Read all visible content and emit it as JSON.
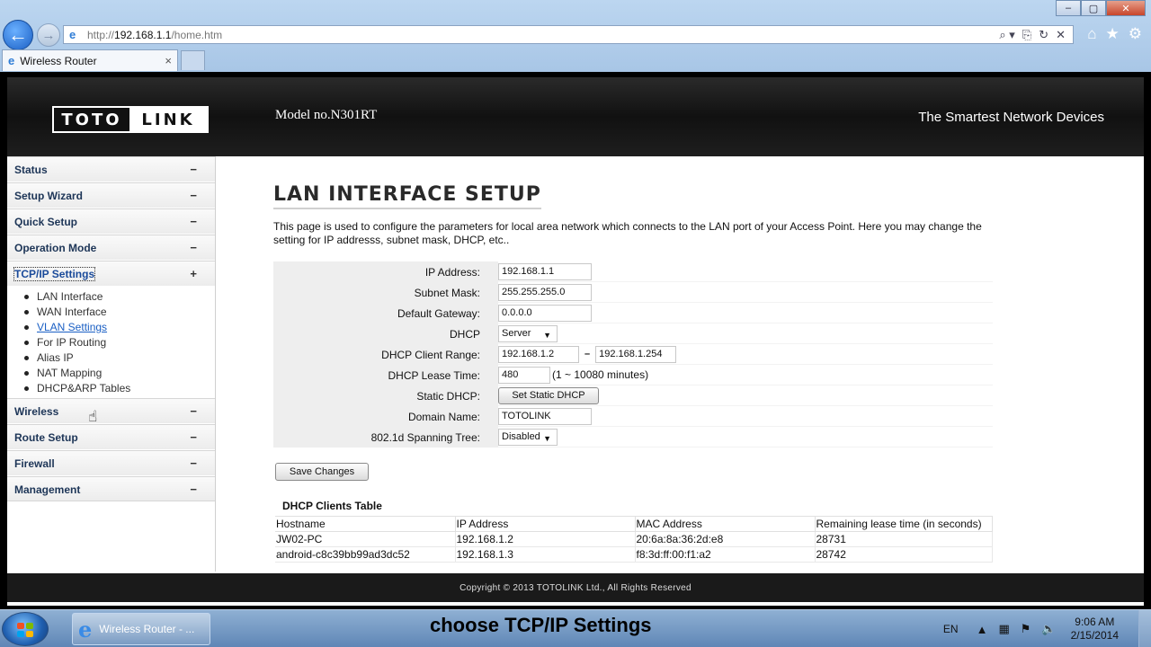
{
  "browser": {
    "url_prefix": "http://",
    "url_host": "192.168.1.1",
    "url_path": "/home.htm",
    "tab_title": "Wireless Router",
    "tab_close": "×",
    "window_buttons": [
      "–",
      "▢",
      "✕"
    ],
    "address_tools": [
      "⌕ ▾",
      "⎘",
      "↻",
      "✕"
    ],
    "toolbar_icons": {
      "home": "⌂",
      "favorites": "★",
      "tools": "⚙"
    }
  },
  "banner": {
    "logo_left": "TOTO",
    "logo_right": "LINK",
    "model": "Model no.N301RT",
    "slogan": "The Smartest Network Devices"
  },
  "sidebar": {
    "items": [
      {
        "label": "Status",
        "sign": "−"
      },
      {
        "label": "Setup Wizard",
        "sign": "−"
      },
      {
        "label": "Quick Setup",
        "sign": "−"
      },
      {
        "label": "Operation Mode",
        "sign": "−"
      },
      {
        "label": "TCP/IP Settings",
        "sign": "+"
      },
      {
        "label": "Wireless",
        "sign": "−"
      },
      {
        "label": "Route Setup",
        "sign": "−"
      },
      {
        "label": "Firewall",
        "sign": "−"
      },
      {
        "label": "Management",
        "sign": "−"
      }
    ],
    "submenu": [
      "LAN Interface",
      "WAN Interface",
      "VLAN Settings",
      "For IP Routing",
      "Alias IP",
      "NAT Mapping",
      "DHCP&ARP Tables"
    ]
  },
  "content": {
    "title": "LAN INTERFACE SETUP",
    "description": "This page is used to configure the parameters for local area network which connects to the LAN port of your Access Point. Here you may change the setting for IP addresss, subnet mask, DHCP, etc..",
    "form": {
      "ip_label": "IP Address:",
      "ip_value": "192.168.1.1",
      "mask_label": "Subnet Mask:",
      "mask_value": "255.255.255.0",
      "gateway_label": "Default Gateway:",
      "gateway_value": "0.0.0.0",
      "dhcp_label": "DHCP",
      "dhcp_value": "Server",
      "range_label": "DHCP Client Range:",
      "range_start": "192.168.1.2",
      "range_sep": "–",
      "range_end": "192.168.1.254",
      "lease_label": "DHCP Lease Time:",
      "lease_value": "480",
      "lease_hint": "(1 ~ 10080 minutes)",
      "static_label": "Static DHCP:",
      "static_button": "Set Static DHCP",
      "domain_label": "Domain Name:",
      "domain_value": "TOTOLINK",
      "stp_label": "802.1d Spanning Tree:",
      "stp_value": "Disabled"
    },
    "save_button": "Save Changes",
    "clients_title": "DHCP Clients Table",
    "clients_headers": [
      "Hostname",
      "IP Address",
      "MAC Address",
      "Remaining lease time (in seconds)"
    ],
    "clients_rows": [
      [
        "JW02-PC",
        "192.168.1.2",
        "20:6a:8a:36:2d:e8",
        "28731"
      ],
      [
        "android-c8c39bb99ad3dc52",
        "192.168.1.3",
        "f8:3d:ff:00:f1:a2",
        "28742"
      ]
    ]
  },
  "footer": {
    "copyright": "Copyright © 2013 TOTOLINK Ltd.,   All Rights Reserved"
  },
  "taskbar": {
    "app_label": "Wireless Router - ...",
    "caption": "choose TCP/IP Settings",
    "lang": "EN",
    "time": "9:06 AM",
    "date": "2/15/2014"
  }
}
